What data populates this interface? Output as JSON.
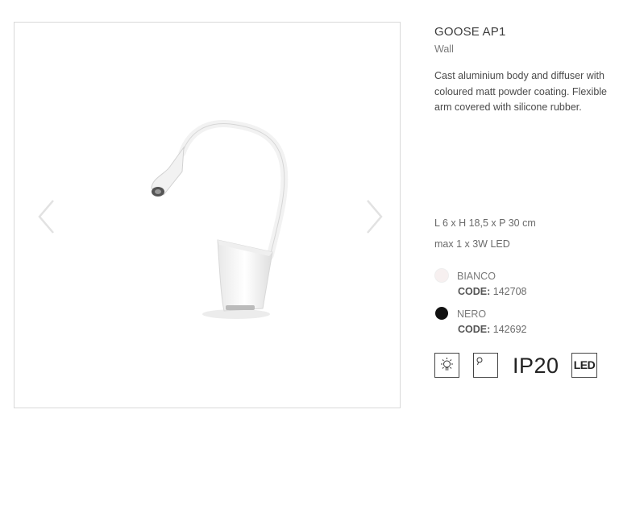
{
  "product": {
    "name": "GOOSE AP1",
    "category": "Wall",
    "description": "Cast aluminium body and diffuser with coloured matt powder coating. Flexible arm covered with silicone rubber.",
    "dimensions": "L 6 x H 18,5 x P 30 cm",
    "lamp": "max 1 x 3W LED"
  },
  "gallery": {
    "prev_icon": "chevron-left-icon",
    "next_icon": "chevron-right-icon"
  },
  "variants": [
    {
      "color_name": "BIANCO",
      "code_label": "CODE:",
      "code": "142708",
      "swatch_color": "#f7f0f0"
    },
    {
      "color_name": "NERO",
      "code_label": "CODE:",
      "code": "142692",
      "swatch_color": "#111111"
    }
  ],
  "certifications": {
    "icons": [
      "led-light-icon",
      "lamp-bulb-icon"
    ],
    "ip_rating": "IP20",
    "led_badge": "LED"
  }
}
